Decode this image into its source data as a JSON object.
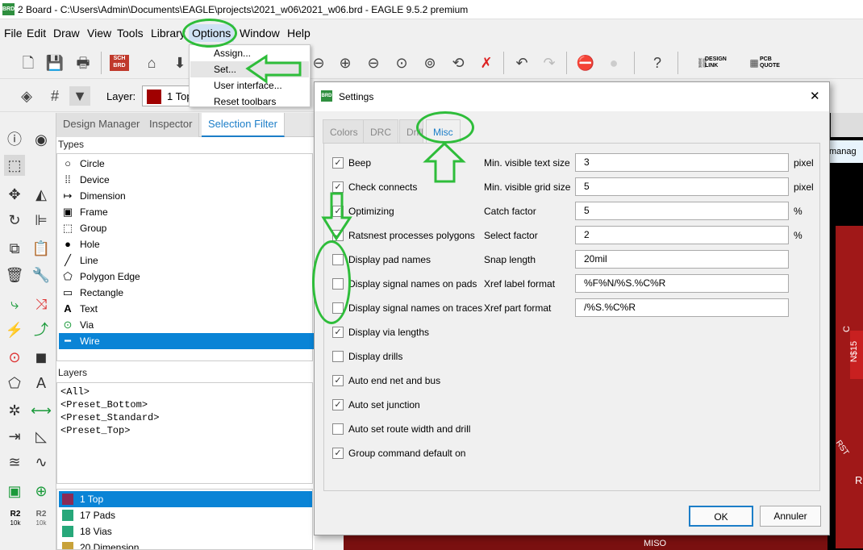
{
  "window": {
    "title": "2 Board - C:\\Users\\Admin\\Documents\\EAGLE\\projects\\2021_w06\\2021_w06.brd - EAGLE 9.5.2 premium",
    "app_icon_text": "BRD"
  },
  "menu": [
    "File",
    "Edit",
    "Draw",
    "View",
    "Tools",
    "Library",
    "Options",
    "Window",
    "Help"
  ],
  "options_menu": [
    "Assign...",
    "Set...",
    "User interface...",
    "Reset toolbars"
  ],
  "toolbar": {
    "design_link": "DESIGN\nLINK",
    "pcb_quote": "PCB\nQUOTE",
    "sch_label": "SCH\nBRD"
  },
  "toolbar2": {
    "layer_label": "Layer:",
    "layer_value": "1 Top",
    "layer_color": "#a00000"
  },
  "panel": {
    "tabs": [
      "Design Manager",
      "Inspector",
      "Selection Filter"
    ],
    "types_label": "Types",
    "layers_label": "Layers",
    "types": [
      {
        "label": "Circle",
        "icon": "circle-icon"
      },
      {
        "label": "Device",
        "icon": "device-icon"
      },
      {
        "label": "Dimension",
        "icon": "dimension-icon"
      },
      {
        "label": "Frame",
        "icon": "frame-icon"
      },
      {
        "label": "Group",
        "icon": "group-icon"
      },
      {
        "label": "Hole",
        "icon": "hole-icon"
      },
      {
        "label": "Line",
        "icon": "line-icon"
      },
      {
        "label": "Polygon Edge",
        "icon": "polygon-icon"
      },
      {
        "label": "Rectangle",
        "icon": "rectangle-icon"
      },
      {
        "label": "Text",
        "icon": "text-icon"
      },
      {
        "label": "Via",
        "icon": "via-icon"
      },
      {
        "label": "Wire",
        "icon": "wire-icon"
      }
    ],
    "presets": [
      "<All>",
      "<Preset_Bottom>",
      "<Preset_Standard>",
      "<Preset_Top>"
    ],
    "board_layers": [
      {
        "label": "1 Top",
        "color": "#8b2b55"
      },
      {
        "label": "17 Pads",
        "color": "#27a87a"
      },
      {
        "label": "18 Vias",
        "color": "#27a87a"
      },
      {
        "label": "20 Dimension",
        "color": "#c8a23a"
      }
    ]
  },
  "left_tools": {
    "r2_a": "R2",
    "r2_a_sub": "10k",
    "r2_b": "R2",
    "r2_b_sub": "10k"
  },
  "board": {
    "labels": [
      "manag",
      "C",
      "N$15",
      "RST",
      "R",
      "MISO"
    ]
  },
  "dialog": {
    "title": "Settings",
    "icon_text": "BRD",
    "tabs": [
      "Colors",
      "DRC",
      "Drill",
      "Misc"
    ],
    "checkboxes": [
      {
        "label": "Beep",
        "checked": true
      },
      {
        "label": "Check connects",
        "checked": true
      },
      {
        "label": "Optimizing",
        "checked": true
      },
      {
        "label": "Ratsnest processes polygons",
        "checked": true
      },
      {
        "label": "Display pad names",
        "checked": false
      },
      {
        "label": "Display signal names on pads",
        "checked": false
      },
      {
        "label": "Display signal names on traces",
        "checked": false
      },
      {
        "label": "Display via lengths",
        "checked": true
      },
      {
        "label": "Display drills",
        "checked": false
      },
      {
        "label": "Auto end net and bus",
        "checked": true
      },
      {
        "label": "Auto set junction",
        "checked": true
      },
      {
        "label": "Auto set route width and drill",
        "checked": false
      },
      {
        "label": "Group command default on",
        "checked": true
      }
    ],
    "fields": [
      {
        "label": "Min. visible text size",
        "value": "3",
        "unit": "pixel"
      },
      {
        "label": "Min. visible grid size",
        "value": "5",
        "unit": "pixel"
      },
      {
        "label": "Catch factor",
        "value": "5",
        "unit": "%"
      },
      {
        "label": "Select factor",
        "value": "2",
        "unit": "%"
      },
      {
        "label": "Snap length",
        "value": "20mil",
        "unit": ""
      },
      {
        "label": "Xref label format",
        "value": "%F%N/%S.%C%R",
        "unit": ""
      },
      {
        "label": "Xref part format",
        "value": "/%S.%C%R",
        "unit": ""
      }
    ],
    "ok": "OK",
    "cancel": "Annuler",
    "close": "✕"
  }
}
